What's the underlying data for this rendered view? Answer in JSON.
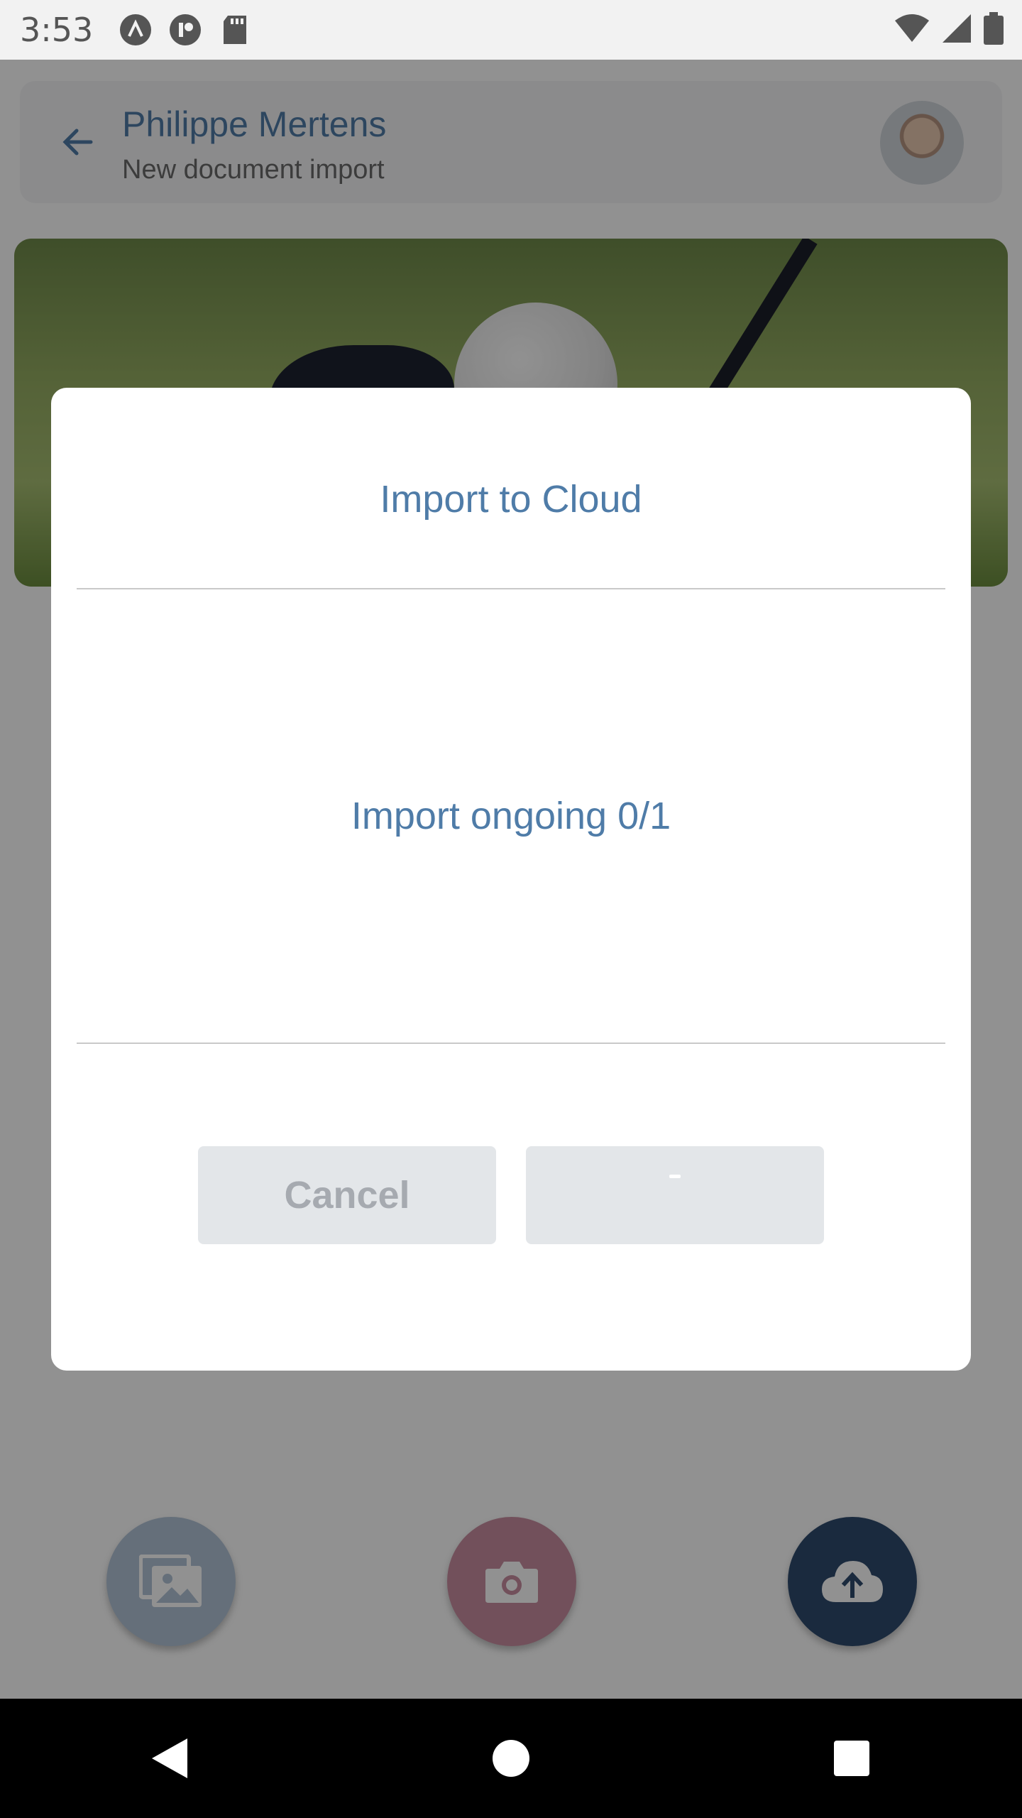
{
  "status_bar": {
    "time": "3:53",
    "left_icons": [
      "app-notification-icon",
      "app-notification-icon-2",
      "sd-card-icon"
    ],
    "right_icons": [
      "wifi-icon",
      "cellular-signal-icon",
      "battery-icon"
    ]
  },
  "header": {
    "back_icon": "arrow-back-icon",
    "title": "Philippe Mertens",
    "subtitle": "New document import"
  },
  "fabs": [
    {
      "icon": "gallery-icon",
      "color": "#b2c4d7"
    },
    {
      "icon": "camera-icon",
      "color": "#c98ea1"
    },
    {
      "icon": "cloud-upload-icon",
      "color": "#2f4b6e"
    }
  ],
  "dialog": {
    "title": "Import to Cloud",
    "message": "Import ongoing 0/1",
    "cancel_label": "Cancel",
    "confirm_label": ""
  },
  "nav_bar": {
    "icons": [
      "back-triangle-icon",
      "home-circle-icon",
      "recents-square-icon"
    ]
  },
  "colors": {
    "accent": "#4f7ca8",
    "button_bg": "#e3e6e9",
    "button_text": "#a6aab0"
  }
}
